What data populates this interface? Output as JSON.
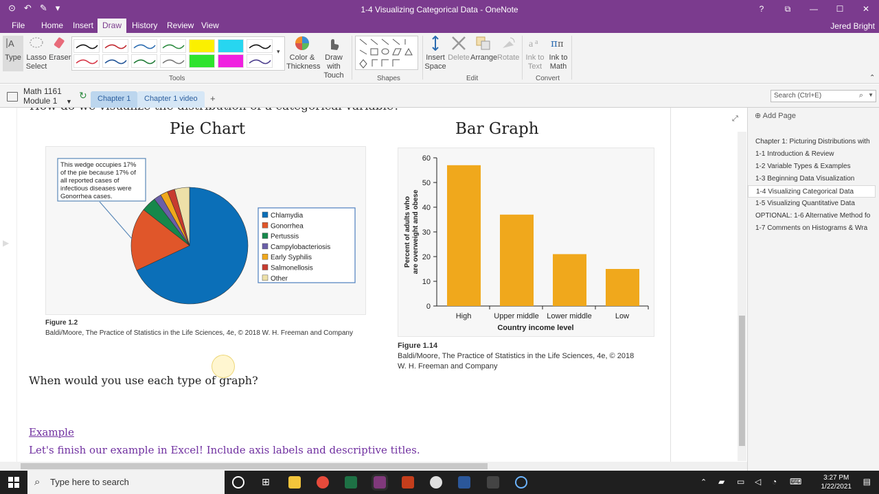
{
  "window": {
    "title": "1-4 Visualizing Categorical Data - OneNote",
    "controls": [
      "?",
      "⧉",
      "—",
      "☐",
      "✕"
    ]
  },
  "menu": {
    "tabs": [
      "File",
      "Home",
      "Insert",
      "Draw",
      "History",
      "Review",
      "View"
    ],
    "active": "Draw",
    "user": "Jered Bright"
  },
  "ribbon": {
    "type": "Type",
    "lasso_1": "Lasso",
    "lasso_2": "Select",
    "eraser": "Eraser",
    "color_1": "Color &",
    "color_2": "Thickness",
    "drawtouch_1": "Draw with",
    "drawtouch_2": "Touch",
    "insert_1": "Insert",
    "insert_2": "Space",
    "delete": "Delete",
    "arrange": "Arrange",
    "rotate": "Rotate",
    "inktotext_1": "Ink to",
    "inktotext_2": "Text",
    "inktomath_1": "Ink to",
    "inktomath_2": "Math",
    "groups": [
      "Tools",
      "Shapes",
      "Edit",
      "Convert"
    ]
  },
  "notebook": {
    "name": "Math 1161",
    "section_group": "Module 1",
    "sections": [
      "Chapter 1",
      "Chapter 1 video",
      "+"
    ]
  },
  "search": {
    "placeholder": "Search (Ctrl+E)"
  },
  "pages": {
    "add": "Add Page",
    "items": [
      "Chapter 1: Picturing Distributions with",
      "1-1 Introduction & Review",
      "1-2 Variable Types & Examples",
      "1-3 Beginning Data Visualization",
      "1-4 Visualizing Categorical Data",
      "1-5 Visualizing Quantitative Data",
      "OPTIONAL: 1-6 Alternative Method fo",
      "1-7 Comments on Histograms & Wra"
    ]
  },
  "content": {
    "top_line": "How do we visualize the distribution of a categorical variable?",
    "pie_heading": "Pie Chart",
    "bar_heading": "Bar Graph",
    "pie_callout": [
      "This wedge occupies 17%",
      "of the pie because 17% of",
      "all reported cases of",
      "infectious diseases were",
      "Gonorrhea cases."
    ],
    "pie_fig": "Figure 1.2",
    "pie_src": "Baldi/Moore, The Practice of Statistics in the Life Sciences, 4e, © 2018 W. H. Freeman and Company",
    "bar_fig": "Figure 1.14",
    "bar_src_1": "Baldi/Moore, The Practice of Statistics in the Life Sciences, 4e, © 2018",
    "bar_src_2": "W. H. Freeman and Company",
    "question": "When would you use each type of graph?",
    "example_title": "Example",
    "example_text": "Let's finish our example in Excel!  Include axis labels and descriptive titles."
  },
  "chart_data": [
    {
      "type": "pie",
      "title": "",
      "categories": [
        "Chlamydia",
        "Gonorrhea",
        "Pertussis",
        "Campylobacteriosis",
        "Early Syphilis",
        "Salmonellosis",
        "Other"
      ],
      "values": [
        66,
        17,
        4,
        2,
        2,
        2,
        4
      ],
      "colors": [
        "#0b6fb8",
        "#e0562a",
        "#16884b",
        "#6a5fa8",
        "#f0a81c",
        "#c73b2f",
        "#ede0a8"
      ],
      "legend": "right"
    },
    {
      "type": "bar",
      "title": "",
      "categories": [
        "High",
        "Upper middle",
        "Lower middle",
        "Low"
      ],
      "values": [
        57,
        37,
        21,
        15
      ],
      "xlabel": "Country income level",
      "ylabel": "Percent of adults who are overweight and obese",
      "ylim": [
        0,
        60
      ],
      "yticks": [
        0,
        10,
        20,
        30,
        40,
        50,
        60
      ],
      "color": "#f0a81c"
    }
  ],
  "taskbar": {
    "search": "Type here to search",
    "time": "3:27 PM",
    "date": "1/22/2021"
  }
}
